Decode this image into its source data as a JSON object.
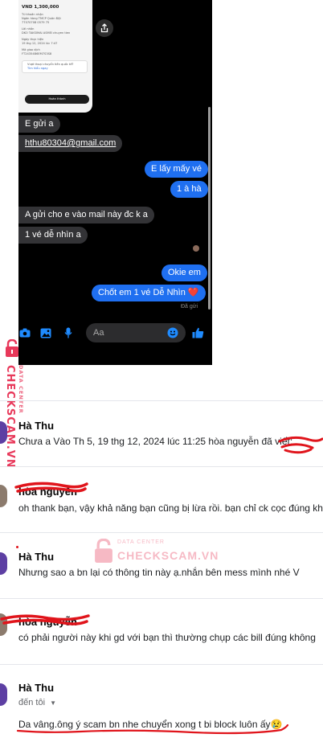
{
  "messenger": {
    "receipt": {
      "amount": "VND 1,300,000",
      "lines": [
        "Từ khoản nhận",
        "Ngân hàng TMCP Quân Đội",
        "77070708 0579 75",
        "Lời nhắn",
        "DKO TAKSIMAI ASMEI chuyen tien",
        "Ngày thực hiện",
        "19 thg 12, 2024 lúc 7:47",
        "Mã giao dịch",
        "FT24354B6EM7S3S8",
        "Vượt thoại chuyển tiền quốc tế?",
        "Tìm hiểu ngay"
      ],
      "button": "Hoàn thành"
    },
    "messages": [
      {
        "side": "in",
        "text": "E gửi a"
      },
      {
        "side": "in",
        "text": "hthu80304@gmail.com",
        "link": true
      },
      {
        "side": "out",
        "text": "E lấy mấy vé"
      },
      {
        "side": "out",
        "text": "1 à hà"
      },
      {
        "side": "in",
        "text": "A gửi cho e vào mail này đc k a"
      },
      {
        "side": "in",
        "text": "1 vé dễ nhìn a"
      },
      {
        "side": "out",
        "text": "Okie em"
      },
      {
        "side": "out",
        "text": "Chốt em 1 vé Dễ Nhìn ❤️"
      }
    ],
    "seen": "Đã gửi",
    "composer": {
      "placeholder": "Aa",
      "icons": [
        "camera-icon",
        "image-icon",
        "mic-icon",
        "emoji-icon",
        "thumbs-up-icon"
      ]
    }
  },
  "watermark": {
    "brand": "CHECKSCAM.VN",
    "sub": "DATA CENTER"
  },
  "comments": [
    {
      "name": "Hà Thu",
      "text": "Chưa a Vào Th 5, 19 thg 12, 2024 lúc 11:25 hòa nguyễn đã viết:"
    },
    {
      "name": "hòa nguyễn",
      "text": "oh thank bạn, vậy khả năng bạn cũng bị lừa rồi. bạn chỉ ck cọc đúng không"
    },
    {
      "name": "Hà Thu",
      "text": "Nhưng sao a bn lại có thông tin này ạ.nhắn bên mess mình nhé V"
    },
    {
      "name": "hòa nguyễn",
      "text": "có phải người này khi gd với bạn thì thường chụp các bill đúng không"
    },
    {
      "name": "Hà Thu",
      "meta": "đến tôi",
      "text": "Da vâng.ông ý scam bn nhe chuyển xong t bi block luôn ấy😢"
    }
  ],
  "colors": {
    "messenger_blue": "#1f6ff0",
    "incoming_bubble": "#333336",
    "watermark": "#e8385a",
    "scribble": "#e0141b",
    "avatar_purple": "#5d3fa3"
  }
}
